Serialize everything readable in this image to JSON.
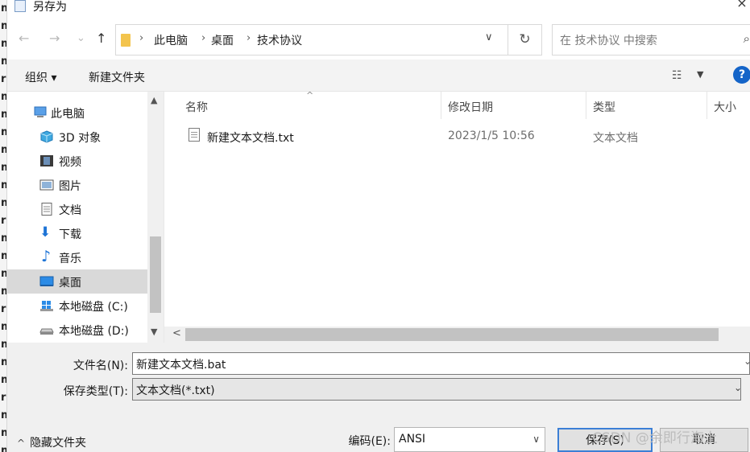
{
  "window": {
    "title": "另存为",
    "close_glyph": "×"
  },
  "left_strip": [
    "m",
    "m",
    "m",
    "m",
    "r",
    "m",
    "m",
    "m",
    "m",
    "m",
    "m",
    "m",
    "r",
    "m",
    "m",
    "m",
    "m",
    "r",
    "m",
    "m",
    "m",
    "m",
    "r",
    "m",
    "m",
    "m"
  ],
  "address": {
    "back": "←",
    "forward": "→",
    "recent": "⌄",
    "up": "↑",
    "crumbs": [
      "此电脑",
      "桌面",
      "技术协议"
    ],
    "sep": "›",
    "dropdown": "∨",
    "refresh": "↻"
  },
  "search": {
    "placeholder": "在 技术协议 中搜索",
    "icon": "search-icon",
    "glyph": "⌕"
  },
  "toolbar": {
    "organize": "组织 ▾",
    "new_folder": "新建文件夹",
    "view_glyph": "☷",
    "view_dd": "▼",
    "help": "?"
  },
  "sidebar": {
    "items": [
      {
        "label": "此电脑",
        "icon": "computer-icon"
      },
      {
        "label": "3D 对象",
        "icon": "cube-icon"
      },
      {
        "label": "视频",
        "icon": "film-icon"
      },
      {
        "label": "图片",
        "icon": "picture-icon"
      },
      {
        "label": "文档",
        "icon": "document-icon"
      },
      {
        "label": "下载",
        "icon": "download-icon",
        "glyph": "⬇"
      },
      {
        "label": "音乐",
        "icon": "music-icon",
        "glyph": "♪"
      },
      {
        "label": "桌面",
        "icon": "desktop-icon",
        "selected": true
      },
      {
        "label": "本地磁盘 (C:)",
        "icon": "windows-drive-icon"
      },
      {
        "label": "本地磁盘 (D:)",
        "icon": "drive-icon"
      }
    ],
    "scroll_up": "▲",
    "scroll_down": "▼"
  },
  "columns": {
    "name": "名称",
    "modified": "修改日期",
    "type": "类型",
    "size": "大小",
    "sort_glyph": "^"
  },
  "files": [
    {
      "name": "新建文本文档.txt",
      "modified": "2023/1/5 10:56",
      "type": "文本文档"
    }
  ],
  "hscroll_left": "<",
  "form": {
    "filename_label": "文件名(N):",
    "filename_value": "新建文本文档.bat",
    "filename_dd": "⌄",
    "filetype_label": "保存类型(T):",
    "filetype_value": "文本文档(*.txt)",
    "filetype_dd": "⌄",
    "hide_folders": "隐藏文件夹",
    "hide_chev": "^",
    "encoding_label": "编码(E):",
    "encoding_value": "ANSI",
    "encoding_dd": "∨",
    "save": "保存(S)",
    "cancel": "取消"
  },
  "watermark": "CSDN @余即行海上",
  "colors": {
    "selected": "#d9d9d9",
    "accent": "#3b7fd6",
    "help": "#1464c8",
    "folder": "#f3c44d"
  }
}
